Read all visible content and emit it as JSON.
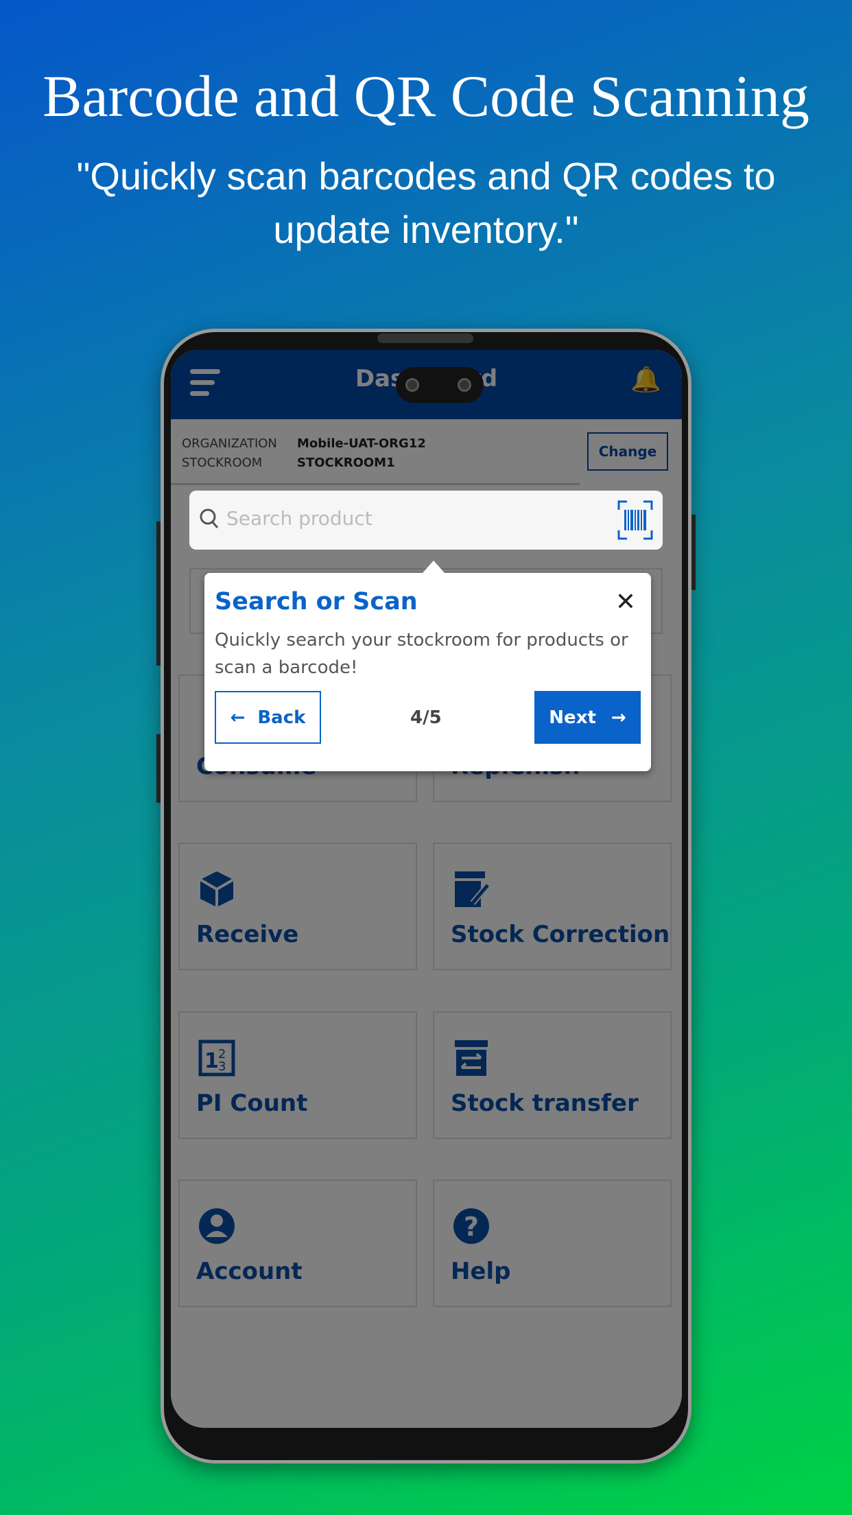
{
  "hero": {
    "title": "Barcode and QR Code Scanning",
    "subtitle": "\"Quickly scan barcodes and QR codes to update inventory.\""
  },
  "app": {
    "header": {
      "title": "Dashboard",
      "menu_icon": "hamburger-icon",
      "bell_icon": "bell-icon"
    },
    "info": {
      "org_label": "ORGANIZATION",
      "org_value": "Mobile-UAT-ORG12",
      "stockroom_label": "STOCKROOM",
      "stockroom_value": "STOCKROOM1",
      "change_label": "Change"
    },
    "search": {
      "placeholder": "Search product",
      "scan_icon": "barcode-scan-icon"
    },
    "tiles": [
      {
        "label": "Consume",
        "icon": "consume-icon"
      },
      {
        "label": "Replenish",
        "icon": "replenish-icon"
      },
      {
        "label": "Receive",
        "icon": "box-icon"
      },
      {
        "label": "Stock Correction",
        "icon": "clipboard-edit-icon"
      },
      {
        "label": "PI Count",
        "icon": "count-icon"
      },
      {
        "label": "Stock transfer",
        "icon": "transfer-icon"
      },
      {
        "label": "Account",
        "icon": "account-icon"
      },
      {
        "label": "Help",
        "icon": "help-icon"
      }
    ],
    "tour": {
      "title": "Search or Scan",
      "body": "Quickly search your stockroom for products or scan a barcode!",
      "back": "Back",
      "next": "Next",
      "step": "4/5"
    },
    "colors": {
      "primary": "#0048a6",
      "accent": "#0a63c9"
    }
  }
}
